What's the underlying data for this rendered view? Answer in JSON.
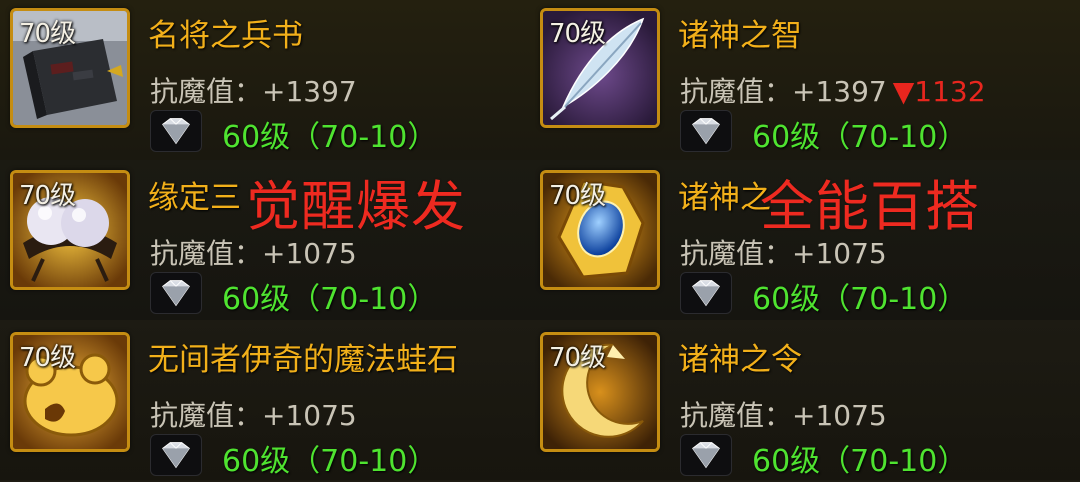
{
  "stat_label": "抗魔值：",
  "items": [
    {
      "level": "70级",
      "name": "名将之兵书",
      "stat": "+1397",
      "stat_down": "",
      "req": "60级（70-10）",
      "icon": "book-icon"
    },
    {
      "level": "70级",
      "name": "诸神之智",
      "stat": "+1397",
      "stat_down": "▼1132",
      "req": "60级（70-10）",
      "icon": "feather-icon"
    },
    {
      "level": "70级",
      "name": "缘定三",
      "stat": "+1075",
      "stat_down": "",
      "req": "60级（70-10）",
      "icon": "pearls-icon"
    },
    {
      "level": "70级",
      "name": "诸神之",
      "stat": "+1075",
      "stat_down": "",
      "req": "60级（70-10）",
      "icon": "sapphire-amulet-icon"
    },
    {
      "level": "70级",
      "name": "无间者伊奇的魔法蛙石",
      "stat": "+1075",
      "stat_down": "",
      "req": "60级（70-10）",
      "icon": "frog-stone-icon"
    },
    {
      "level": "70级",
      "name": "诸神之令",
      "stat": "+1075",
      "stat_down": "",
      "req": "60级（70-10）",
      "icon": "crescent-icon"
    }
  ],
  "overlays": {
    "left": "觉醒爆发",
    "right": "全能百搭"
  },
  "colors": {
    "name": "#f2b01a",
    "stat": "#c9c4b6",
    "down": "#e8261e",
    "req": "#4fe330",
    "frame": "#c58d12",
    "overlay": "#ee2a20"
  }
}
